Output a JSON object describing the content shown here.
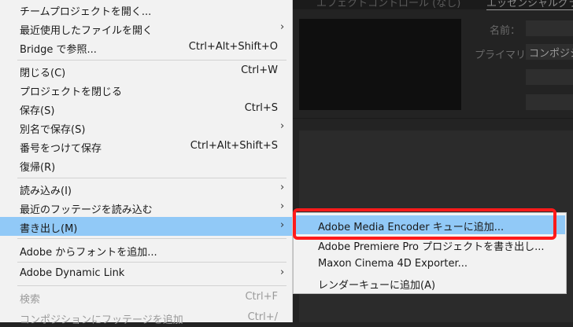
{
  "background": {
    "tab_effect_controls": "エフェクトコントロール (なし)",
    "tab_essential_graphics": "エッセンシャルグラフ",
    "name_label": "名前：",
    "primary_label": "プライマリ：",
    "primary_value": "コンポジシ"
  },
  "menu": {
    "items": [
      {
        "label": "チームプロジェクトを開く..."
      },
      {
        "label": "最近使用したファイルを開く"
      },
      {
        "label": "Bridge で参照...",
        "shortcut": "Ctrl+Alt+Shift+O"
      },
      {
        "label": "閉じる(C)",
        "shortcut": "Ctrl+W"
      },
      {
        "label": "プロジェクトを閉じる"
      },
      {
        "label": "保存(S)",
        "shortcut": "Ctrl+S"
      },
      {
        "label": "別名で保存(S)"
      },
      {
        "label": "番号をつけて保存",
        "shortcut": "Ctrl+Alt+Shift+S"
      },
      {
        "label": "復帰(R)"
      },
      {
        "label": "読み込み(I)"
      },
      {
        "label": "最近のフッテージを読み込む"
      },
      {
        "label": "書き出し(M)"
      },
      {
        "label": "Adobe からフォントを追加..."
      },
      {
        "label": "Adobe Dynamic Link"
      },
      {
        "label": "検索",
        "shortcut": "Ctrl+F"
      },
      {
        "label": "コンポジションにフッテージを追加",
        "shortcut": "Ctrl+/"
      }
    ],
    "submenu_arrow": "›"
  },
  "submenu": {
    "items": [
      {
        "label": "Adobe Media Encoder キューに追加..."
      },
      {
        "label": "Adobe Premiere Pro プロジェクトを書き出し..."
      },
      {
        "label": "Maxon Cinema 4D Exporter..."
      },
      {
        "label": "レンダーキューに追加(A)"
      }
    ]
  }
}
